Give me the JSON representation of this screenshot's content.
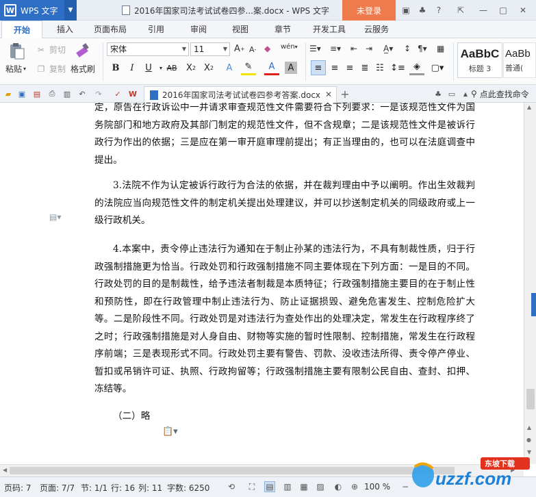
{
  "app": {
    "name": "WPS 文字",
    "logo": "W"
  },
  "title_bar": {
    "document_title": "2016年国家司法考试试卷四参...案.docx - WPS 文字",
    "login": "未登录"
  },
  "menu_tabs": [
    {
      "label": "开始",
      "active": true
    },
    {
      "label": "插入"
    },
    {
      "label": "页面布局"
    },
    {
      "label": "引用"
    },
    {
      "label": "审阅"
    },
    {
      "label": "视图"
    },
    {
      "label": "章节"
    },
    {
      "label": "开发工具"
    },
    {
      "label": "云服务"
    }
  ],
  "ribbon": {
    "paste": "粘贴",
    "cut": "剪切",
    "copy": "复制",
    "format_painter": "格式刷",
    "font_name": "宋体",
    "font_size": "11",
    "styles": [
      {
        "preview": "AaBbC",
        "name": "标题 3"
      },
      {
        "preview": "AaBb",
        "name": "普通("
      }
    ]
  },
  "tab_bar": {
    "document_tab": "2016年国家司法考试试卷四参考答案.docx",
    "search_commands": "点此查找命令"
  },
  "document": {
    "paragraphs": [
      "定，原告在行政诉讼中一并请求审查规范性文件需要符合下列要求：一是该规范性文件为国务院部门和地方政府及其部门制定的规范性文件，但不含规章；二是该规范性文件是被诉行政行为作出的依据；三是应在第一审开庭审理前提出；有正当理由的，也可以在法庭调查中提出。",
      "3.法院不作为认定被诉行政行为合法的依据，并在裁判理由中予以阐明。作出生效裁判的法院应当向规范性文件的制定机关提出处理建议，并可以抄送制定机关的同级政府或上一级行政机关。",
      "4.本案中，责令停止违法行为通知在于制止孙某的违法行为，不具有制裁性质，归于行政强制措施更为恰当。行政处罚和行政强制措施不同主要体现在下列方面：一是目的不同。行政处罚的目的是制裁性，给予违法者制裁是本质特征；行政强制措施主要目的在于制止性和预防性，即在行政管理中制止违法行为、防止证据损毁、避免危害发生、控制危险扩大等。二是阶段性不同。行政处罚是对违法行为查处作出的处理决定，常发生在行政程序终了之时；行政强制措施是对人身自由、财物等实施的暂时性限制、控制措施，常发生在行政程序前端；三是表现形式不同。行政处罚主要有警告、罚款、没收违法所得、责令停产停业、暂扣或吊销许可证、执照、行政拘留等；行政强制措施主要有限制公民自由、查封、扣押、冻结等。",
      "（二）略"
    ]
  },
  "status_bar": {
    "page": "页码: 7",
    "pages": "页面: 7/7",
    "section": "节: 1/1",
    "row": "行: 16",
    "col": "列: 11",
    "words": "字数: 6250",
    "zoom": "100 %"
  },
  "watermark": {
    "brand": "uzzf.com",
    "tag": "东坡下载"
  },
  "colors": {
    "accent": "#2e6ec4",
    "login": "#ef7b4c"
  }
}
